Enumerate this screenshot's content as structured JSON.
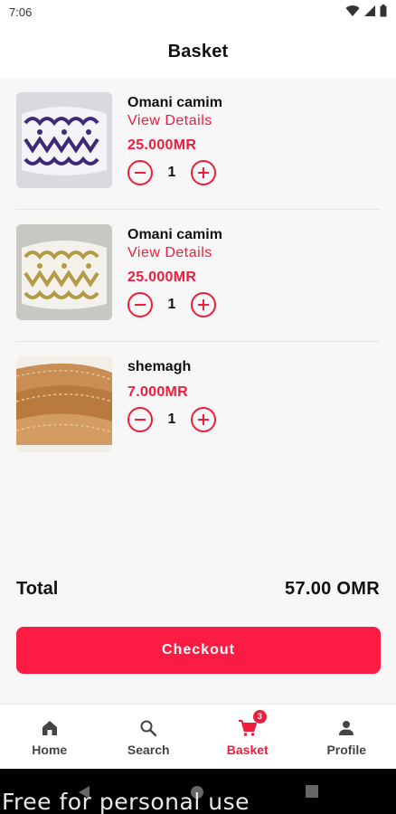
{
  "status_bar": {
    "time": "7:06",
    "icons": [
      "wifi-icon",
      "signal-icon",
      "battery-icon"
    ]
  },
  "header": {
    "title": "Basket"
  },
  "basket": {
    "items": [
      {
        "name": "Omani camim",
        "details_link": "View Details",
        "price": "25.000MR",
        "quantity": "1",
        "image": "kuma-purple-cap-image"
      },
      {
        "name": "Omani camim",
        "details_link": "View Details",
        "price": "25.000MR",
        "quantity": "1",
        "image": "kuma-gold-cap-image"
      },
      {
        "name": "shemagh",
        "price": "7.000MR",
        "quantity": "1",
        "image": "shemagh-fabric-image"
      }
    ]
  },
  "summary": {
    "total_label": "Total",
    "total_value": "57.00 OMR"
  },
  "actions": {
    "checkout_label": "Checkout"
  },
  "bottom_nav": {
    "items": [
      {
        "label": "Home",
        "icon": "home-icon"
      },
      {
        "label": "Search",
        "icon": "search-icon"
      },
      {
        "label": "Basket",
        "icon": "cart-icon",
        "active": true,
        "badge": "3"
      },
      {
        "label": "Profile",
        "icon": "person-icon"
      }
    ]
  },
  "watermark": "Free for personal use",
  "colors": {
    "accent": "#ee1d3c",
    "button": "#fb1b43",
    "background": "#f7f7f8"
  }
}
